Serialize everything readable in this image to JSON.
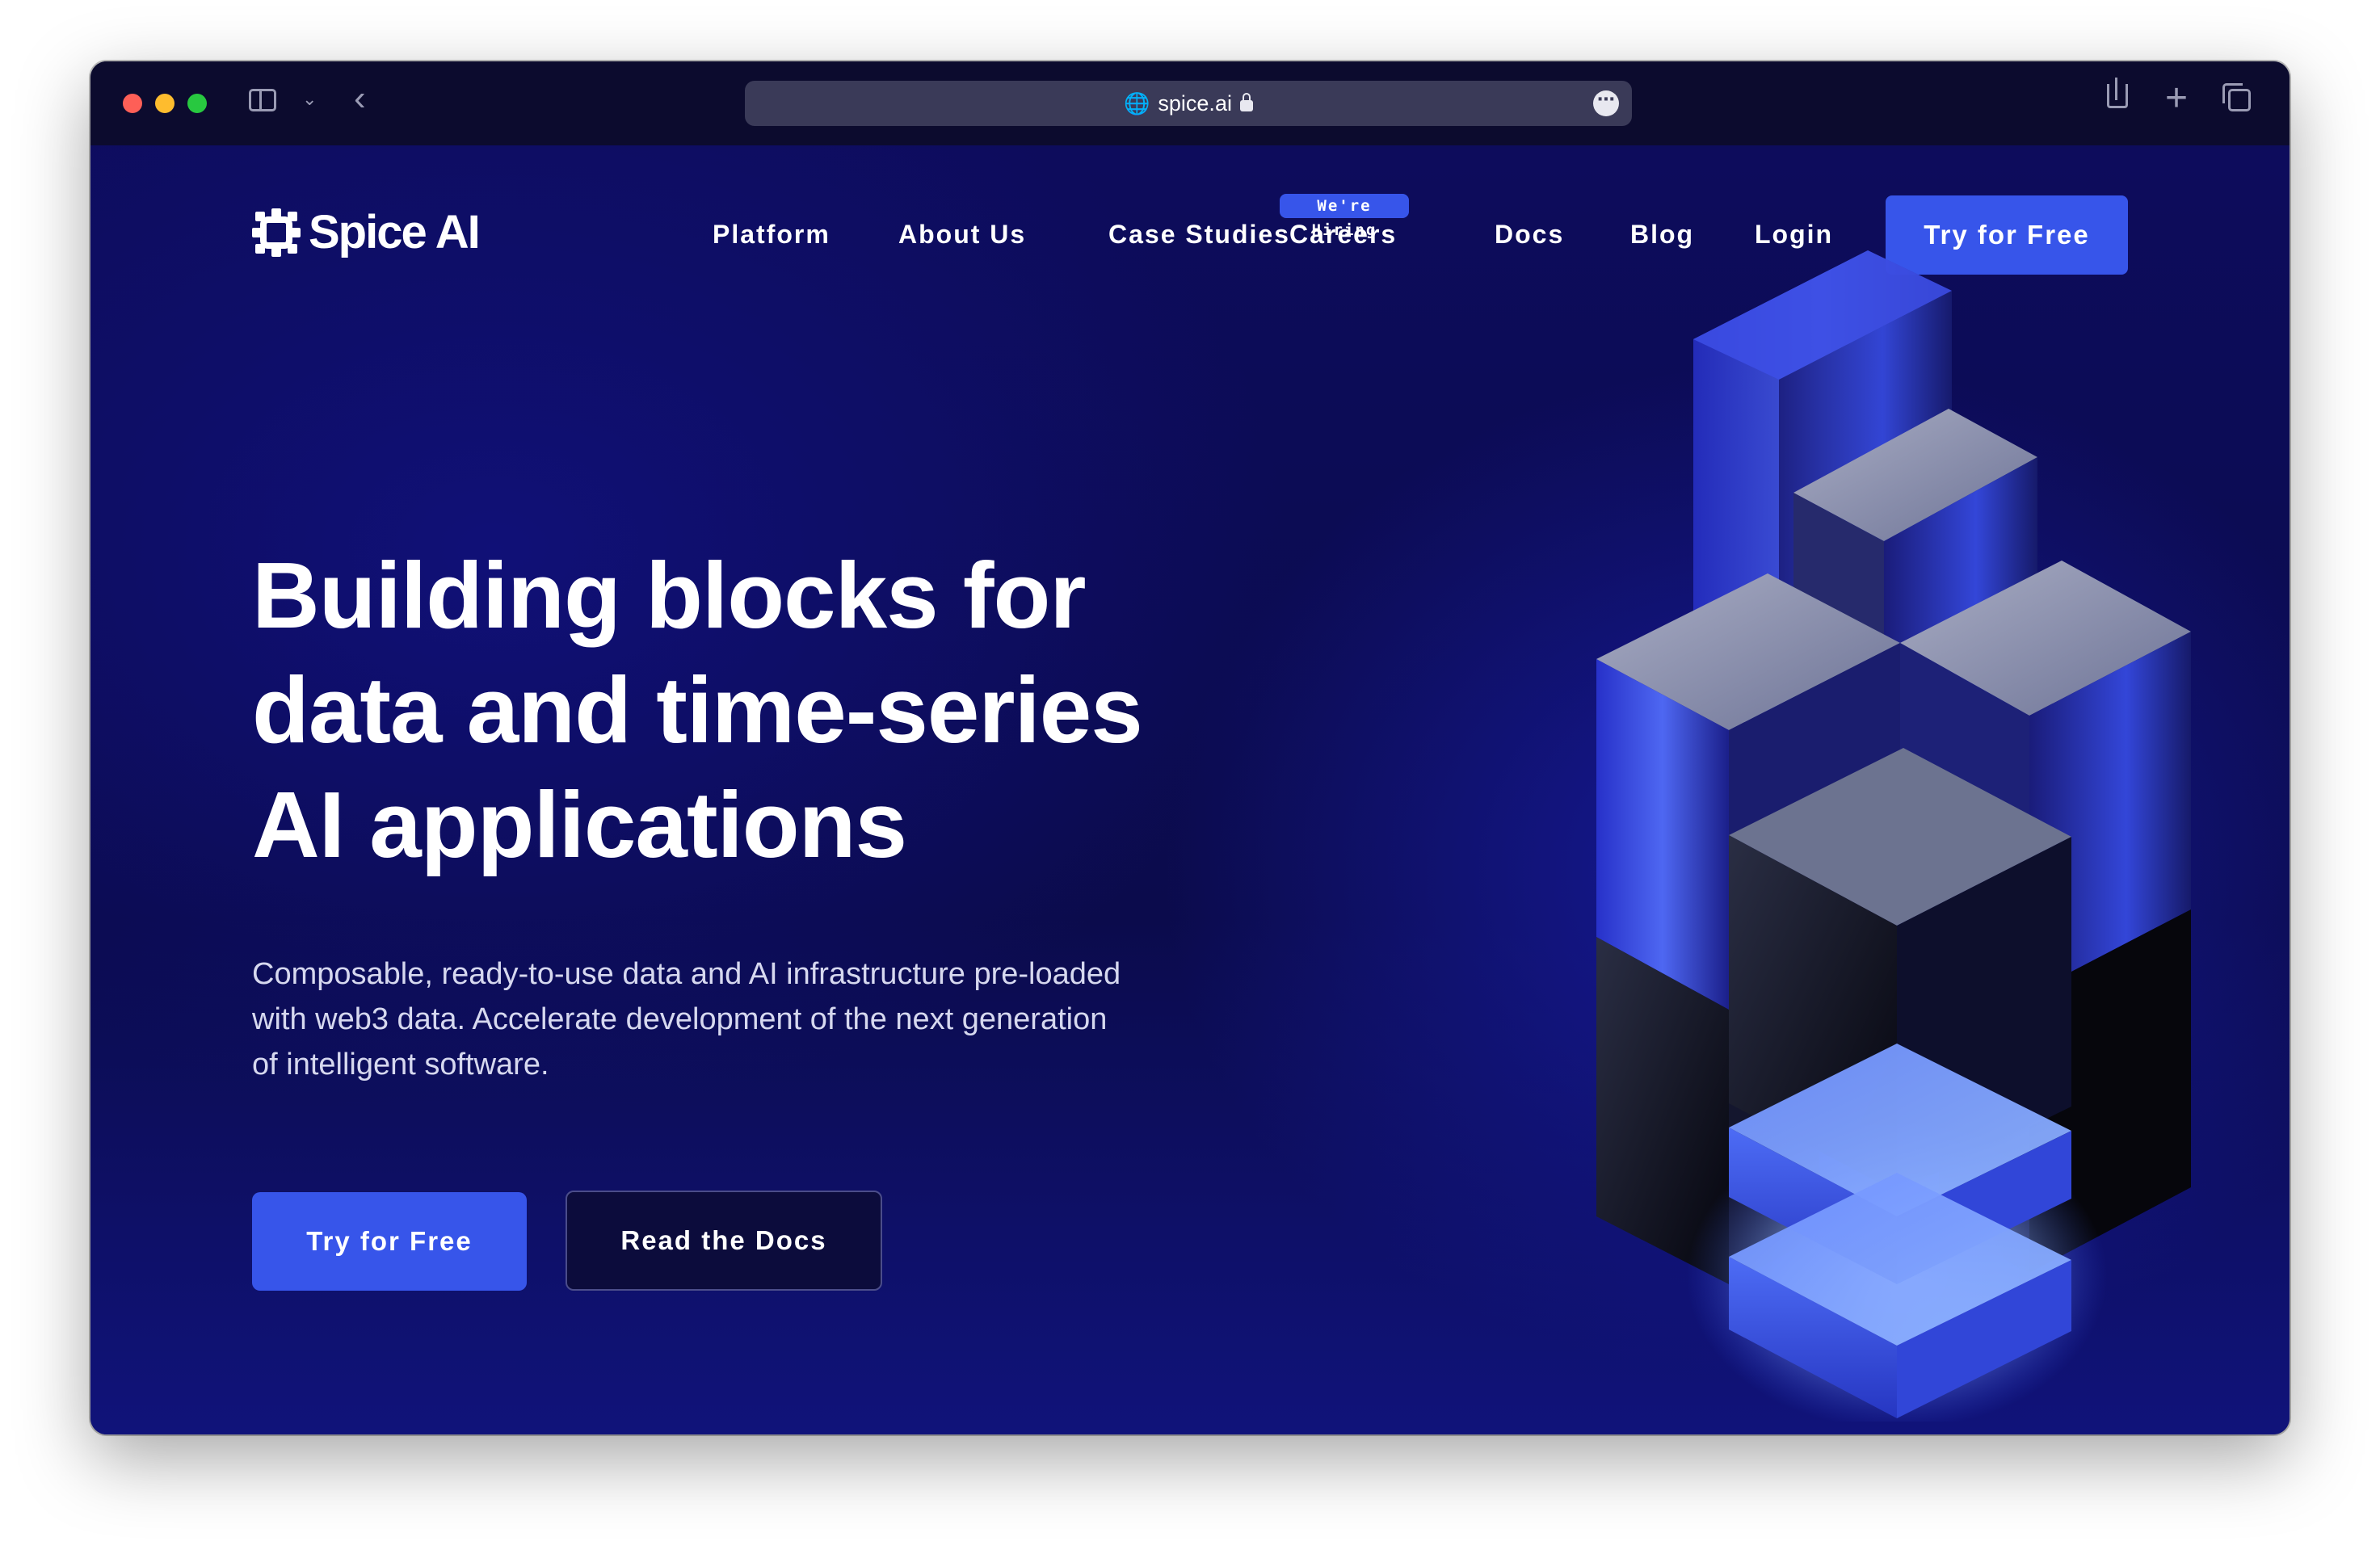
{
  "browser": {
    "url": "spice.ai"
  },
  "site": {
    "logo_text": "Spice AI",
    "nav": {
      "items": [
        "Platform",
        "About Us",
        "Case Studies",
        "Careers",
        "Docs",
        "Blog",
        "Login"
      ],
      "hiring_badge": "We're Hiring",
      "cta": "Try for Free"
    },
    "hero": {
      "title_lines": [
        "Building blocks for",
        "data and time-series",
        "AI applications"
      ],
      "subtitle_lines": [
        "Composable, ready-to-use data and AI infrastructure pre-loaded",
        "with web3 data. Accelerate development of the next generation",
        "of intelligent software."
      ],
      "primary_button": "Try for Free",
      "secondary_button": "Read the Docs"
    }
  },
  "colors": {
    "accent": "#3755ea",
    "background": "#0c0b4a",
    "titlebar": "#0c0b2e"
  }
}
